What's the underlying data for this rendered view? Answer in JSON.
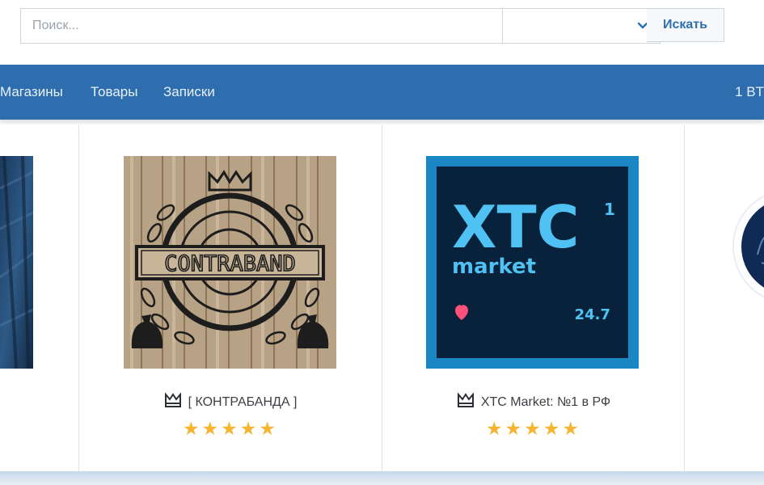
{
  "search": {
    "placeholder": "Поиск...",
    "category_value": "",
    "button_label": "Искать"
  },
  "nav": {
    "items": [
      {
        "label": "Магазины"
      },
      {
        "label": "Товары"
      },
      {
        "label": "Записки"
      }
    ],
    "right_text": "1 BT"
  },
  "shops": [
    {
      "name": "[ КОНТРАБАНДА ]",
      "logo_text": "CONTRABAND",
      "rating": 5
    },
    {
      "name": "XTC Market: №1 в РФ",
      "logo_title": "XTC",
      "logo_subtitle": "market",
      "logo_badge": "1",
      "logo_number": "24.7",
      "rating": 5
    }
  ],
  "colors": {
    "navbar": "#2f6eae",
    "star": "#f6b531",
    "xtc_frame": "#1a86c4",
    "xtc_bg": "#07223a",
    "xtc_text": "#4fc1f2"
  }
}
